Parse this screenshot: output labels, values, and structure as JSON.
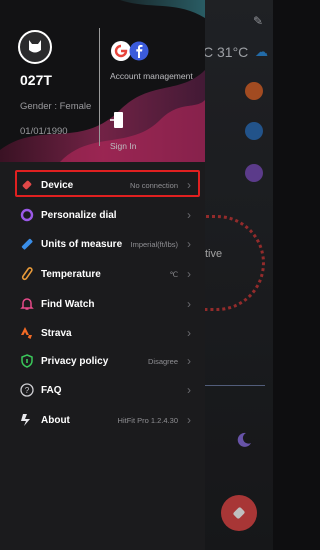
{
  "background": {
    "temperature": "C 31°C"
  },
  "header": {
    "username": "027T",
    "gender": "Gender : Female",
    "birthday": "01/01/1990",
    "account_management_label": "Account management",
    "sign_in_label": "Sign In"
  },
  "menu": {
    "items": [
      {
        "label": "Device",
        "value": "No connection",
        "icon": "device-icon"
      },
      {
        "label": "Personalize dial",
        "value": "",
        "icon": "watch-dial-icon"
      },
      {
        "label": "Units of measure",
        "value": "Imperial(ft/lbs)",
        "icon": "ruler-icon"
      },
      {
        "label": "Temperature",
        "value": "℃",
        "icon": "thermometer-icon"
      },
      {
        "label": "Find Watch",
        "value": "",
        "icon": "bell-icon"
      },
      {
        "label": "Strava",
        "value": "",
        "icon": "strava-icon"
      },
      {
        "label": "Privacy policy",
        "value": "Disagree",
        "icon": "shield-icon"
      },
      {
        "label": "FAQ",
        "value": "",
        "icon": "question-icon"
      },
      {
        "label": "About",
        "value": "HitFit Pro 1.2.4.30",
        "icon": "logo-icon"
      }
    ]
  },
  "colors": {
    "highlight": "#e02020",
    "accent_red": "#e14848",
    "drawer_bg": "#1b1b1d"
  }
}
